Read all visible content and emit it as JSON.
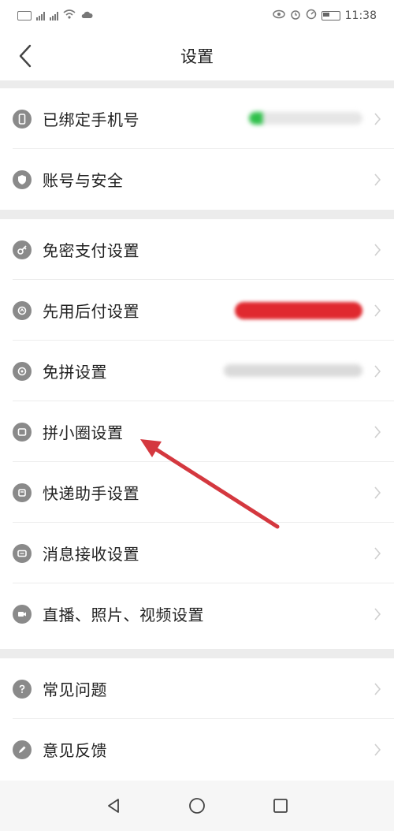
{
  "status_bar": {
    "time": "11:38",
    "left_icons": [
      "sim-icon",
      "signal-icon",
      "signal-icon",
      "wifi-icon",
      "cloud-icon"
    ],
    "right_icons": [
      "eye-icon",
      "alarm-icon",
      "speedometer-icon",
      "battery-icon"
    ]
  },
  "header": {
    "title": "设置",
    "back_icon": "chevron-left-icon"
  },
  "groups": [
    {
      "rows": [
        {
          "name": "bound-phone",
          "label": "已绑定手机号",
          "icon": "phone-icon",
          "value": "redacted (blurred)",
          "accent": "#2fc04a"
        },
        {
          "name": "account-security",
          "label": "账号与安全",
          "icon": "shield-icon"
        }
      ]
    },
    {
      "rows": [
        {
          "name": "password-free-pay",
          "label": "免密支付设置",
          "icon": "key-icon"
        },
        {
          "name": "buy-now-pay-later",
          "label": "先用后付设置",
          "icon": "wallet-icon",
          "value": "redacted (blurred)",
          "accent": "#e0292f"
        },
        {
          "name": "free-group",
          "label": "免拼设置",
          "icon": "target-icon",
          "value": "redacted (blurred)",
          "accent": "#d6d6d6"
        },
        {
          "name": "pin-circle",
          "label": "拼小圈设置",
          "icon": "folder-icon"
        },
        {
          "name": "delivery-assistant",
          "label": "快递助手设置",
          "icon": "truck-icon"
        },
        {
          "name": "message-receive",
          "label": "消息接收设置",
          "icon": "message-icon"
        },
        {
          "name": "live-photo-video",
          "label": "直播、照片、视频设置",
          "icon": "video-icon"
        }
      ]
    },
    {
      "rows": [
        {
          "name": "faq",
          "label": "常见问题",
          "icon": "question-icon"
        },
        {
          "name": "feedback",
          "label": "意见反馈",
          "icon": "pencil-icon"
        }
      ]
    }
  ],
  "nav_bar": {
    "buttons": [
      "back-triangle-icon",
      "home-circle-icon",
      "recents-square-icon"
    ]
  },
  "annotation": {
    "arrow_color": "#d4383f",
    "target": "拼小圈设置"
  },
  "colors": {
    "background": "#ffffff",
    "section_gap": "#ececec",
    "icon_gray": "#8a8a8a",
    "chevron": "#cfcfcf"
  }
}
